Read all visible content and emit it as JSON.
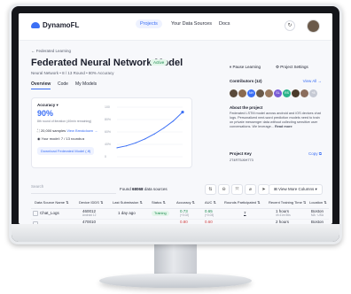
{
  "app": {
    "name": "DynamoFL"
  },
  "nav": {
    "items": [
      "Projects",
      "Your Data Sources",
      "Docs"
    ],
    "active": 0
  },
  "breadcrumb": "← Federated Learning",
  "project": {
    "title": "Federated Neural Network Model",
    "status": "Active",
    "subtitle": "Neural Network • 8 / 13 Round • 80% Accuracy"
  },
  "tabs": [
    "Overview",
    "Code",
    "My Models"
  ],
  "accuracy": {
    "label": "Accuracy ▾",
    "value": "90%",
    "note": "8th round of iteration (40min remaining)",
    "samples": "20,000 samples",
    "samples_link": "View Breakdown →",
    "model": "Your model: 7 / 13 rounds ▸",
    "download": "Download Federated Model (.tf)",
    "y_ticks": [
      "100",
      "80%",
      "60%",
      "40%",
      "0"
    ],
    "accent": "#3b6ff5"
  },
  "chart_data": {
    "type": "line",
    "x": [
      1,
      2,
      3,
      4,
      5,
      6,
      7,
      8
    ],
    "values": [
      18,
      22,
      28,
      36,
      46,
      58,
      72,
      90
    ],
    "ylim": [
      0,
      100
    ],
    "title": "",
    "xlabel": "",
    "ylabel": ""
  },
  "right": {
    "pause": "⏸ Pause Learning",
    "settings": "⚙ Project Settings",
    "contributors_head": "Contributors (12)",
    "view_all": "View All →",
    "contributors": [
      {
        "initials": "",
        "color": "#5a4a3a"
      },
      {
        "initials": "",
        "color": "#8a6a50"
      },
      {
        "initials": "NH",
        "color": "#3b6ff5"
      },
      {
        "initials": "",
        "color": "#6b5a4a"
      },
      {
        "initials": "",
        "color": "#9a7a60"
      },
      {
        "initials": "SL",
        "color": "#7a5cd6"
      },
      {
        "initials": "RS",
        "color": "#2bb38a"
      },
      {
        "initials": "",
        "color": "#4a3a2a"
      },
      {
        "initials": "",
        "color": "#8b6d5c"
      },
      {
        "initials": "+8",
        "color": "#c6cad4"
      }
    ],
    "about_head": "About the project",
    "about_text": "Federated LSTM model across android and iOS devices chat logs. Personalized next-word prediction models need to train on private messenger data without collecting sensitive user conversations. We leverage...",
    "read_more": "Read more",
    "key_head": "Project Key",
    "copy": "Copy ⧉",
    "key_value": "2T4RT5J6H773"
  },
  "toolbar": {
    "search_placeholder": "Search",
    "found_prefix": "Found",
    "found_count": "68068",
    "found_suffix": "data sources",
    "icons": [
      "⇅",
      "⊖",
      "⤧",
      "⌀",
      "➤"
    ],
    "view_more": "⊞ View More Columns ▾"
  },
  "table": {
    "headers": [
      "Data Source Name ⇅",
      "Device IDDS ⇅",
      "Last Submission ⇅",
      "Status ⇅",
      "Accuracy ⇅",
      "AUC ⇅",
      "Rounds Participated ⇅",
      "Recent Training Time ⇅",
      "Location ⇅"
    ],
    "rows": [
      {
        "name": "Chat_Logs",
        "device": "460012",
        "device_sub": "Android 12",
        "submission": "1 day ago",
        "status": "Training",
        "accuracy": "0.73",
        "accuracy_sub": "(+0.02)",
        "auc": "0.65",
        "auc_sub": "(+0.03)",
        "rounds": "7",
        "time": "1 hours",
        "time_sub": "4h 41m 56s",
        "location": "Boston",
        "location_sub": "MA · USA"
      },
      {
        "name": "",
        "device": "470010",
        "device_sub": "",
        "submission": "",
        "status": "",
        "accuracy": "0.80",
        "accuracy_sub": "",
        "auc": "0.60",
        "auc_sub": "",
        "rounds": "",
        "time": "2 hours",
        "time_sub": "",
        "location": "Boston",
        "location_sub": ""
      }
    ]
  }
}
